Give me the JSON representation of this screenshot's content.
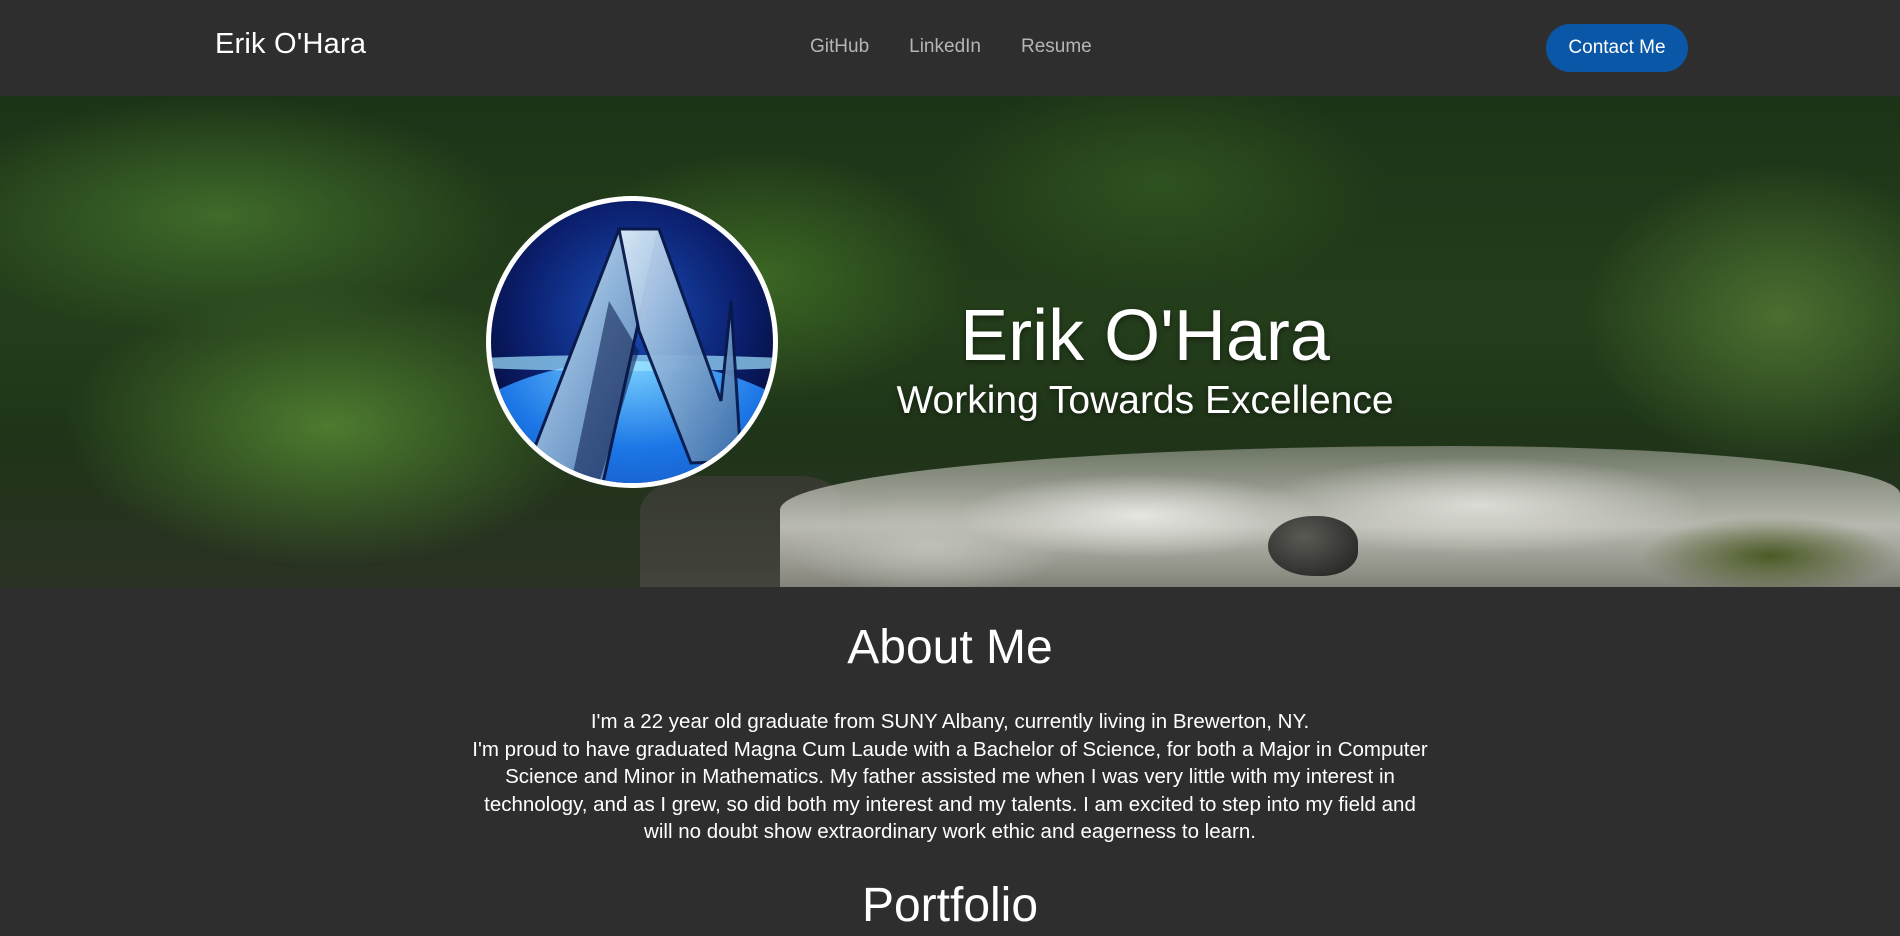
{
  "navbar": {
    "brand": "Erik O'Hara",
    "links": [
      {
        "label": "GitHub"
      },
      {
        "label": "LinkedIn"
      },
      {
        "label": "Resume"
      }
    ],
    "contact_label": "Contact Me"
  },
  "hero": {
    "title": "Erik O'Hara",
    "subtitle": "Working Towards Excellence",
    "avatar_icon": "stylized-A-logo"
  },
  "about": {
    "heading": "About Me",
    "line1": "I'm a 22 year old graduate from SUNY Albany, currently living in Brewerton, NY.",
    "paragraph": "I'm proud to have graduated Magna Cum Laude with a Bachelor of Science, for both a Major in Computer Science and Minor in Mathematics. My father assisted me when I was very little with my interest in technology, and as I grew, so did both my interest and my talents. I am excited to step into my field and will no doubt show extraordinary work ethic and eagerness to learn."
  },
  "portfolio": {
    "heading": "Portfolio"
  },
  "colors": {
    "background": "#2e2e2e",
    "accent": "#0a57a8",
    "nav_link": "#b5b5b5"
  }
}
